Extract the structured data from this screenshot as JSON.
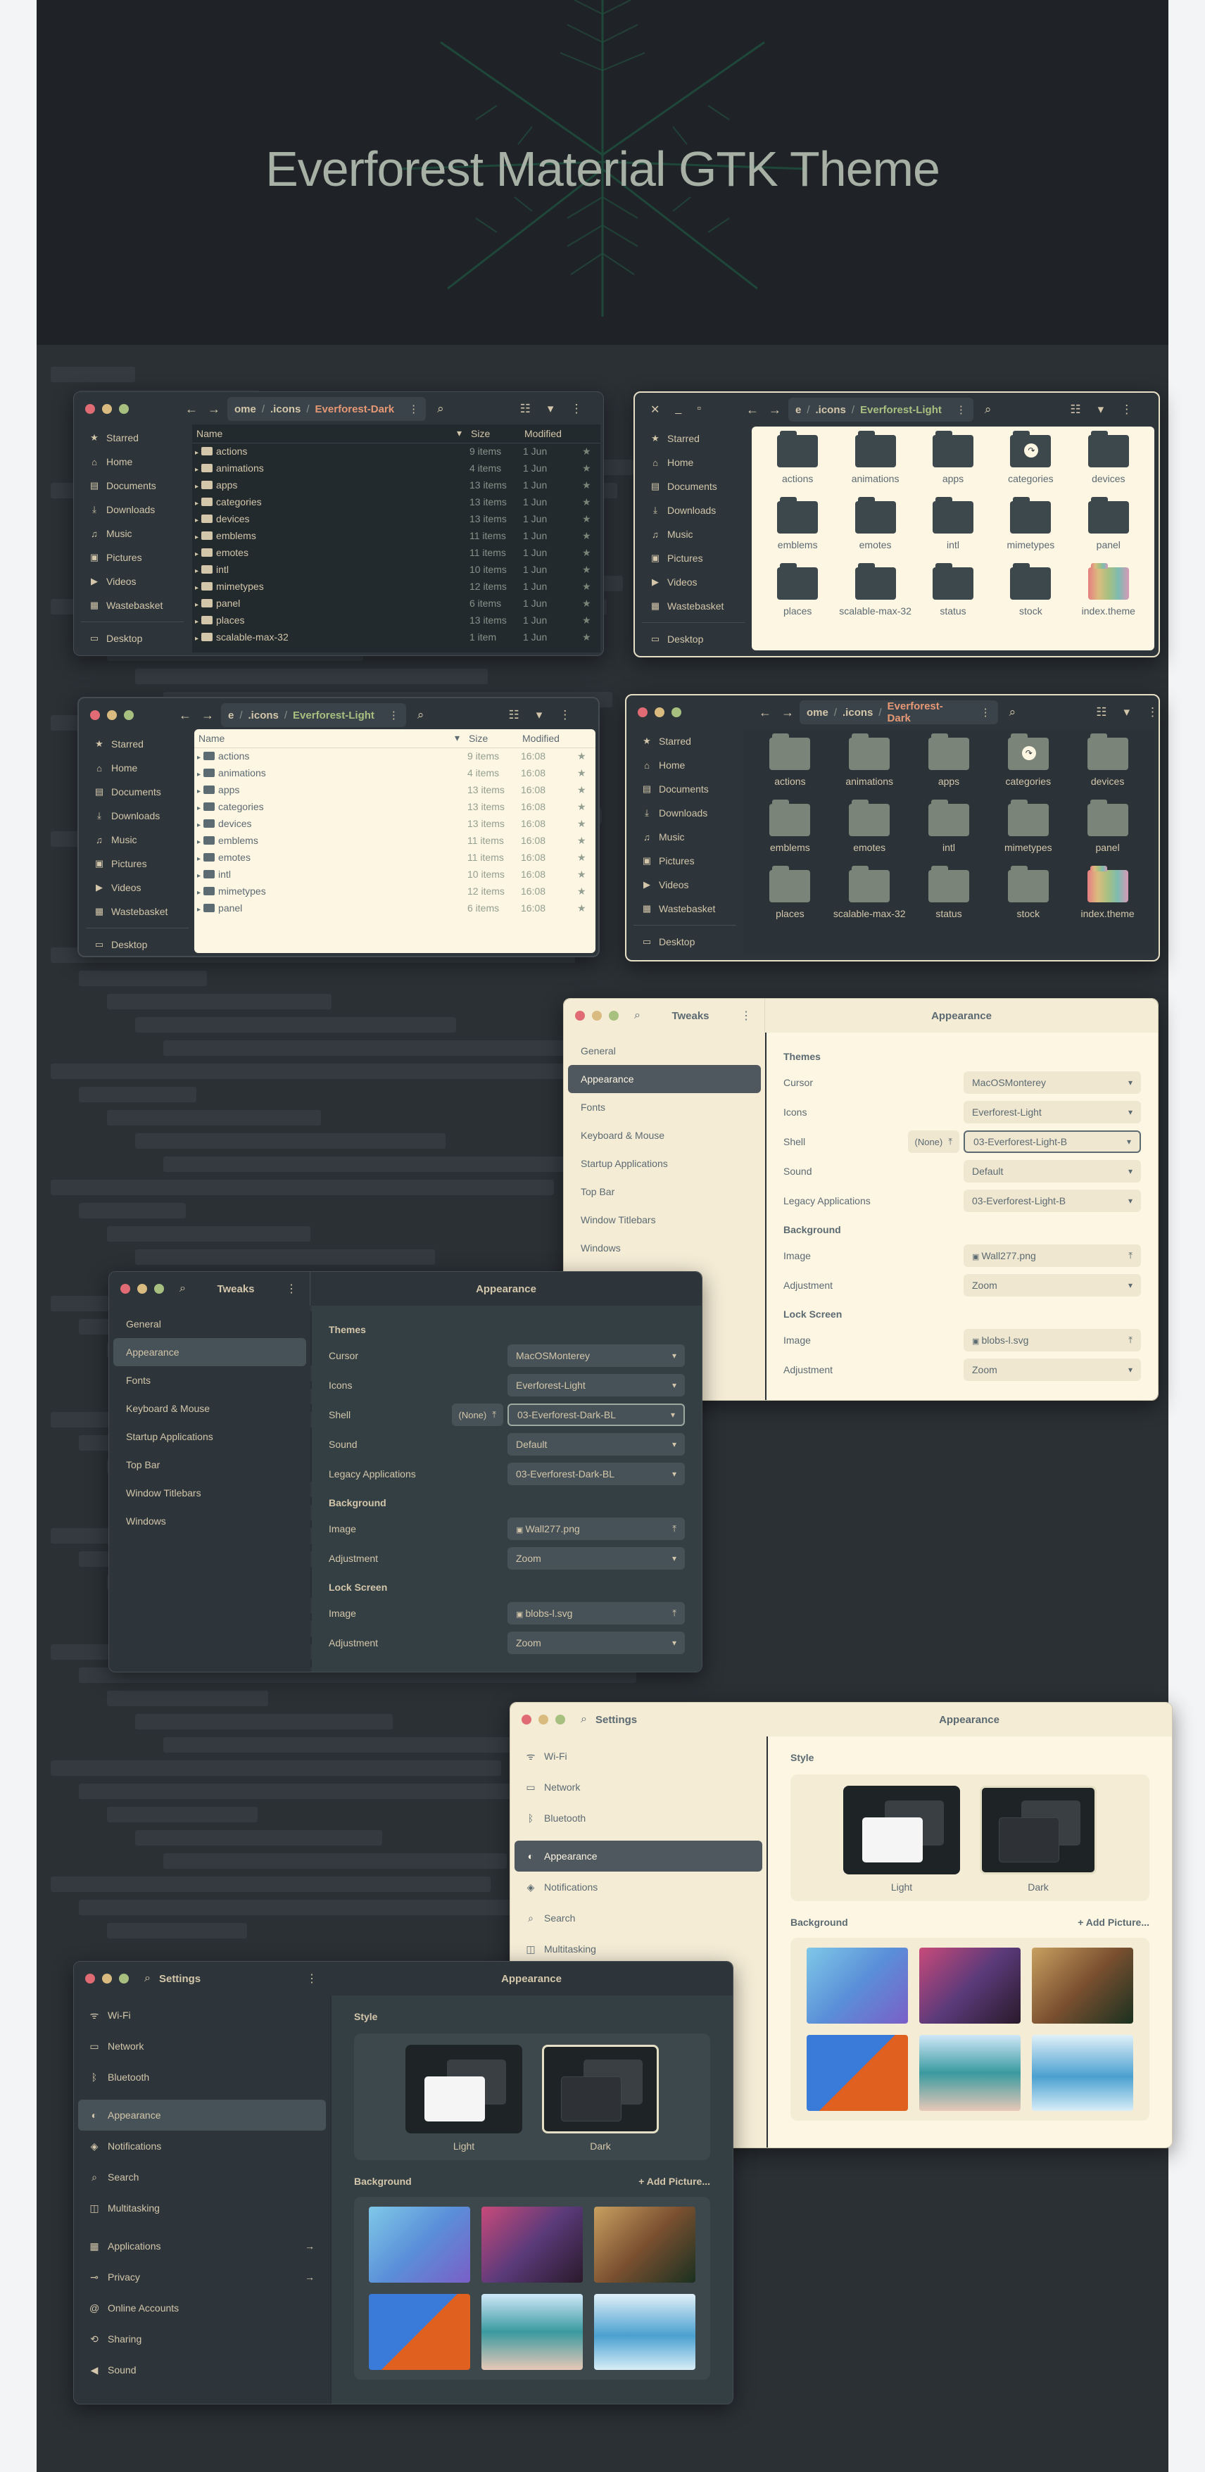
{
  "hero": {
    "title": "Everforest Material GTK Theme"
  },
  "colors": {
    "accent_orange": "#e69875",
    "accent_green": "#a7c080",
    "bg_dark": "#2d353b",
    "bg_light": "#fdf6e3"
  },
  "files_sidebar": {
    "items": [
      {
        "icon": "star-icon",
        "glyph": "★",
        "label": "Starred"
      },
      {
        "icon": "home-icon",
        "glyph": "⌂",
        "label": "Home"
      },
      {
        "icon": "document-icon",
        "glyph": "▤",
        "label": "Documents"
      },
      {
        "icon": "download-icon",
        "glyph": "⤓",
        "label": "Downloads"
      },
      {
        "icon": "music-icon",
        "glyph": "♫",
        "label": "Music"
      },
      {
        "icon": "picture-icon",
        "glyph": "▣",
        "label": "Pictures"
      },
      {
        "icon": "video-icon",
        "glyph": "▶",
        "label": "Videos"
      },
      {
        "icon": "trash-icon",
        "glyph": "▦",
        "label": "Wastebasket"
      }
    ],
    "desktop": {
      "icon": "desktop-icon",
      "glyph": "▭",
      "label": "Desktop"
    }
  },
  "files1": {
    "crumb": {
      "a": "ome",
      "b": ".icons",
      "c": "Everforest-Dark"
    },
    "cols": {
      "name": "Name",
      "size": "Size",
      "modified": "Modified"
    },
    "rows": [
      {
        "name": "actions",
        "size": "9 items",
        "mod": "1 Jun"
      },
      {
        "name": "animations",
        "size": "4 items",
        "mod": "1 Jun"
      },
      {
        "name": "apps",
        "size": "13 items",
        "mod": "1 Jun"
      },
      {
        "name": "categories",
        "size": "13 items",
        "mod": "1 Jun"
      },
      {
        "name": "devices",
        "size": "13 items",
        "mod": "1 Jun"
      },
      {
        "name": "emblems",
        "size": "11 items",
        "mod": "1 Jun"
      },
      {
        "name": "emotes",
        "size": "11 items",
        "mod": "1 Jun"
      },
      {
        "name": "intl",
        "size": "10 items",
        "mod": "1 Jun"
      },
      {
        "name": "mimetypes",
        "size": "12 items",
        "mod": "1 Jun"
      },
      {
        "name": "panel",
        "size": "6 items",
        "mod": "1 Jun"
      },
      {
        "name": "places",
        "size": "13 items",
        "mod": "1 Jun"
      },
      {
        "name": "scalable-max-32",
        "size": "1 item",
        "mod": "1 Jun"
      }
    ]
  },
  "files2": {
    "crumb": {
      "a": "e",
      "b": ".icons",
      "c": "Everforest-Light"
    },
    "icons": [
      "actions",
      "animations",
      "apps",
      "categories",
      "devices",
      "emblems",
      "emotes",
      "intl",
      "mimetypes",
      "panel",
      "places",
      "scalable-max-32",
      "status",
      "stock",
      "index.theme"
    ]
  },
  "files3": {
    "crumb": {
      "a": "e",
      "b": ".icons",
      "c": "Everforest-Light"
    },
    "cols": {
      "name": "Name",
      "size": "Size",
      "modified": "Modified"
    },
    "rows": [
      {
        "name": "actions",
        "size": "9 items",
        "mod": "16:08"
      },
      {
        "name": "animations",
        "size": "4 items",
        "mod": "16:08"
      },
      {
        "name": "apps",
        "size": "13 items",
        "mod": "16:08"
      },
      {
        "name": "categories",
        "size": "13 items",
        "mod": "16:08"
      },
      {
        "name": "devices",
        "size": "13 items",
        "mod": "16:08"
      },
      {
        "name": "emblems",
        "size": "11 items",
        "mod": "16:08"
      },
      {
        "name": "emotes",
        "size": "11 items",
        "mod": "16:08"
      },
      {
        "name": "intl",
        "size": "10 items",
        "mod": "16:08"
      },
      {
        "name": "mimetypes",
        "size": "12 items",
        "mod": "16:08"
      },
      {
        "name": "panel",
        "size": "6 items",
        "mod": "16:08"
      }
    ]
  },
  "files4": {
    "crumb": {
      "a": "ome",
      "b": ".icons",
      "c": "Everforest-Dark"
    },
    "icons": [
      "actions",
      "animations",
      "apps",
      "categories",
      "devices",
      "emblems",
      "emotes",
      "intl",
      "mimetypes",
      "panel",
      "places",
      "scalable-max-32",
      "status",
      "stock",
      "index.theme"
    ]
  },
  "tweaks_sidebar": [
    "General",
    "Appearance",
    "Fonts",
    "Keyboard & Mouse",
    "Startup Applications",
    "Top Bar",
    "Window Titlebars",
    "Windows"
  ],
  "tweaks_light": {
    "app": "Tweaks",
    "title": "Appearance",
    "themes": "Themes",
    "cursor": {
      "label": "Cursor",
      "value": "MacOSMonterey"
    },
    "icons": {
      "label": "Icons",
      "value": "Everforest-Light"
    },
    "shell": {
      "label": "Shell",
      "none": "(None)",
      "value": "03-Everforest-Light-B"
    },
    "sound": {
      "label": "Sound",
      "value": "Default"
    },
    "legacy": {
      "label": "Legacy Applications",
      "value": "03-Everforest-Light-B"
    },
    "background": "Background",
    "bg_image": {
      "label": "Image",
      "value": "Wall277.png"
    },
    "bg_adj": {
      "label": "Adjustment",
      "value": "Zoom"
    },
    "lock": "Lock Screen",
    "lk_image": {
      "label": "Image",
      "value": "blobs-l.svg"
    },
    "lk_adj": {
      "label": "Adjustment",
      "value": "Zoom"
    }
  },
  "tweaks_dark": {
    "app": "Tweaks",
    "title": "Appearance",
    "themes": "Themes",
    "cursor": {
      "label": "Cursor",
      "value": "MacOSMonterey"
    },
    "icons": {
      "label": "Icons",
      "value": "Everforest-Light"
    },
    "shell": {
      "label": "Shell",
      "none": "(None)",
      "value": "03-Everforest-Dark-BL"
    },
    "sound": {
      "label": "Sound",
      "value": "Default"
    },
    "legacy": {
      "label": "Legacy Applications",
      "value": "03-Everforest-Dark-BL"
    },
    "background": "Background",
    "bg_image": {
      "label": "Image",
      "value": "Wall277.png"
    },
    "bg_adj": {
      "label": "Adjustment",
      "value": "Zoom"
    },
    "lock": "Lock Screen",
    "lk_image": {
      "label": "Image",
      "value": "blobs-l.svg"
    },
    "lk_adj": {
      "label": "Adjustment",
      "value": "Zoom"
    }
  },
  "settings_light": {
    "app": "Settings",
    "title": "Appearance",
    "style": "Style",
    "light": "Light",
    "dark": "Dark",
    "background": "Background",
    "add": "Add Picture...",
    "items": [
      {
        "icon": "wifi-icon",
        "glyph": "ᯤ",
        "label": "Wi-Fi"
      },
      {
        "icon": "network-icon",
        "glyph": "▭",
        "label": "Network"
      },
      {
        "icon": "bluetooth-icon",
        "glyph": "ᛒ",
        "label": "Bluetooth"
      },
      {
        "icon": "appearance-icon",
        "glyph": "◐",
        "label": "Appearance"
      },
      {
        "icon": "bell-icon",
        "glyph": "◈",
        "label": "Notifications"
      },
      {
        "icon": "search-icon",
        "glyph": "⌕",
        "label": "Search"
      },
      {
        "icon": "multitasking-icon",
        "glyph": "◫",
        "label": "Multitasking"
      }
    ]
  },
  "settings_dark": {
    "app": "Settings",
    "title": "Appearance",
    "style": "Style",
    "light": "Light",
    "dark": "Dark",
    "background": "Background",
    "add": "Add Picture...",
    "items": [
      {
        "icon": "wifi-icon",
        "glyph": "ᯤ",
        "label": "Wi-Fi"
      },
      {
        "icon": "network-icon",
        "glyph": "▭",
        "label": "Network"
      },
      {
        "icon": "bluetooth-icon",
        "glyph": "ᛒ",
        "label": "Bluetooth"
      },
      {
        "icon": "appearance-icon",
        "glyph": "◐",
        "label": "Appearance"
      },
      {
        "icon": "bell-icon",
        "glyph": "◈",
        "label": "Notifications"
      },
      {
        "icon": "search-icon",
        "glyph": "⌕",
        "label": "Search"
      },
      {
        "icon": "multitasking-icon",
        "glyph": "◫",
        "label": "Multitasking"
      },
      {
        "icon": "apps-icon",
        "glyph": "▦",
        "label": "Applications"
      },
      {
        "icon": "privacy-icon",
        "glyph": "⊸",
        "label": "Privacy"
      },
      {
        "icon": "accounts-icon",
        "glyph": "@",
        "label": "Online Accounts"
      },
      {
        "icon": "sharing-icon",
        "glyph": "⟲",
        "label": "Sharing"
      },
      {
        "icon": "sound-icon",
        "glyph": "◀",
        "label": "Sound"
      }
    ]
  }
}
